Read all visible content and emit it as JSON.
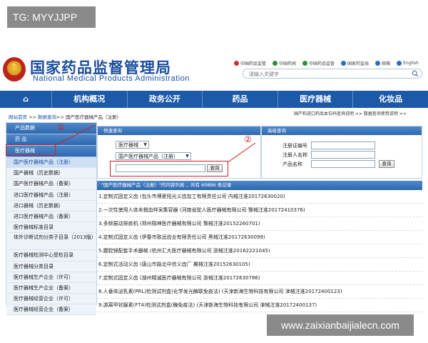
{
  "watermark_top": "TG: MYYJJPP",
  "watermark_bottom": "www.zaixianbaijialecn.com",
  "logo": {
    "cn": "国家药品监督管理局",
    "en": "National Medical Products Administration"
  },
  "top_links": [
    {
      "icon": "weibo-icon",
      "label": "中国药品监管",
      "color": "#d0312d"
    },
    {
      "icon": "globe-icon",
      "label": "中国药闻",
      "color": "#2f8f3a"
    },
    {
      "icon": "wechat-icon",
      "label": "中国药品监管",
      "color": "#2f8f3a"
    },
    {
      "icon": "phone-icon",
      "label": "国家药监局",
      "color": "#2d6fb8"
    },
    {
      "icon": "mail-icon",
      "label": "邮箱",
      "color": "#2d6fb8"
    },
    {
      "icon": "lang-icon",
      "label": "English",
      "color": "#2d6fb8"
    }
  ],
  "search": {
    "placeholder": "请输入关键字"
  },
  "nav": [
    {
      "label": "⌂"
    },
    {
      "label": "机构概况"
    },
    {
      "label": "政务公开"
    },
    {
      "label": "药品"
    },
    {
      "label": "医疗器械"
    },
    {
      "label": "化妆品"
    }
  ],
  "breadcrumb": {
    "home": "网站首页",
    "sep1": " >> ",
    "data_query": "数据查询",
    "sep2": ">> ",
    "current": "国产医疗器械产品（注册）"
  },
  "breadcrumb_right": "国产和进口药品本位码查询说明 >>     数据查询使用说明 >>",
  "sidebar": {
    "categories": [
      "产品数据",
      "药    品",
      "医疗器械"
    ],
    "items": [
      {
        "label": "国产医疗器械产品（注册）",
        "active": true
      },
      {
        "label": "国产器械（历史数据）"
      },
      {
        "label": "国产医疗器械产品（备案）"
      },
      {
        "label": "进口医疗器械产品（注册）"
      },
      {
        "label": "进口器械（历史数据）"
      },
      {
        "label": "进口医疗器械产品（备案）"
      },
      {
        "label": "医疗器械标准目录"
      },
      {
        "label": "体外诊断试剂分类子目录（2013版）",
        "tall": true
      },
      {
        "label": "医疗器械检测中心受检目录"
      },
      {
        "label": "医疗器械分类目录"
      },
      {
        "label": "医疗器械生产企业（许可）"
      },
      {
        "label": "医疗器械生产企业（备案）"
      },
      {
        "label": "医疗器械经营企业（许可）"
      },
      {
        "label": "医疗器械经营企业（备案）"
      }
    ]
  },
  "markers": {
    "one": "①",
    "two": "②"
  },
  "quick_query": {
    "title": "快速查询",
    "select1": "医疗器械",
    "select2": "国产医疗器械产品（注册）",
    "input_value": "",
    "button": "查询"
  },
  "advanced_query": {
    "title": "高级查询",
    "fields": [
      "注册证编号",
      "注册人名称",
      "产品名称"
    ],
    "button": "查询"
  },
  "results": {
    "header": "\"国产医疗器械产品（注册）\"的内容列表 ，共有 60886 条记录",
    "rows": [
      "1.定制式固定义齿 (包头市博爱阳光义齿加工有限责任公司 内械注准20172630020)",
      "2.一次性使用人体末梢血样采集容器 (河南省驼人医疗器械有限公司 豫械注准20172410376)",
      "3.多频振动排痰机 (郑州翔坤医疗器械有限公司 豫械注准20152260701)",
      "4.定制式固定义齿 (伊春市致远齿业有限责任公司 黑械注准20172630099)",
      "5.腹腔镜配套手术器械 (杭州汇大医疗器械有限公司 浙械注准20162221045)",
      "6.定制式活动义齿 (唐山市路北中信义齿厂 冀械注准20152630105)",
      "7.定制式固定义齿 (湖州精诚医疗器械有限公司 浙械注准20172630786)",
      "8.人垂体泌乳素(PRL)检测试剂盒(化学发光酶联免疫法) (天津新海生物科技有限公司 津械注准20172400123)",
      "9.游离甲状腺素(FT4)检测试剂盒(酶免疫法) (天津新海生物科技有限公司 津械注准20172400137)"
    ]
  },
  "colors": {
    "brand_blue": "#1c5aa8",
    "marker_red": "#d02020"
  }
}
